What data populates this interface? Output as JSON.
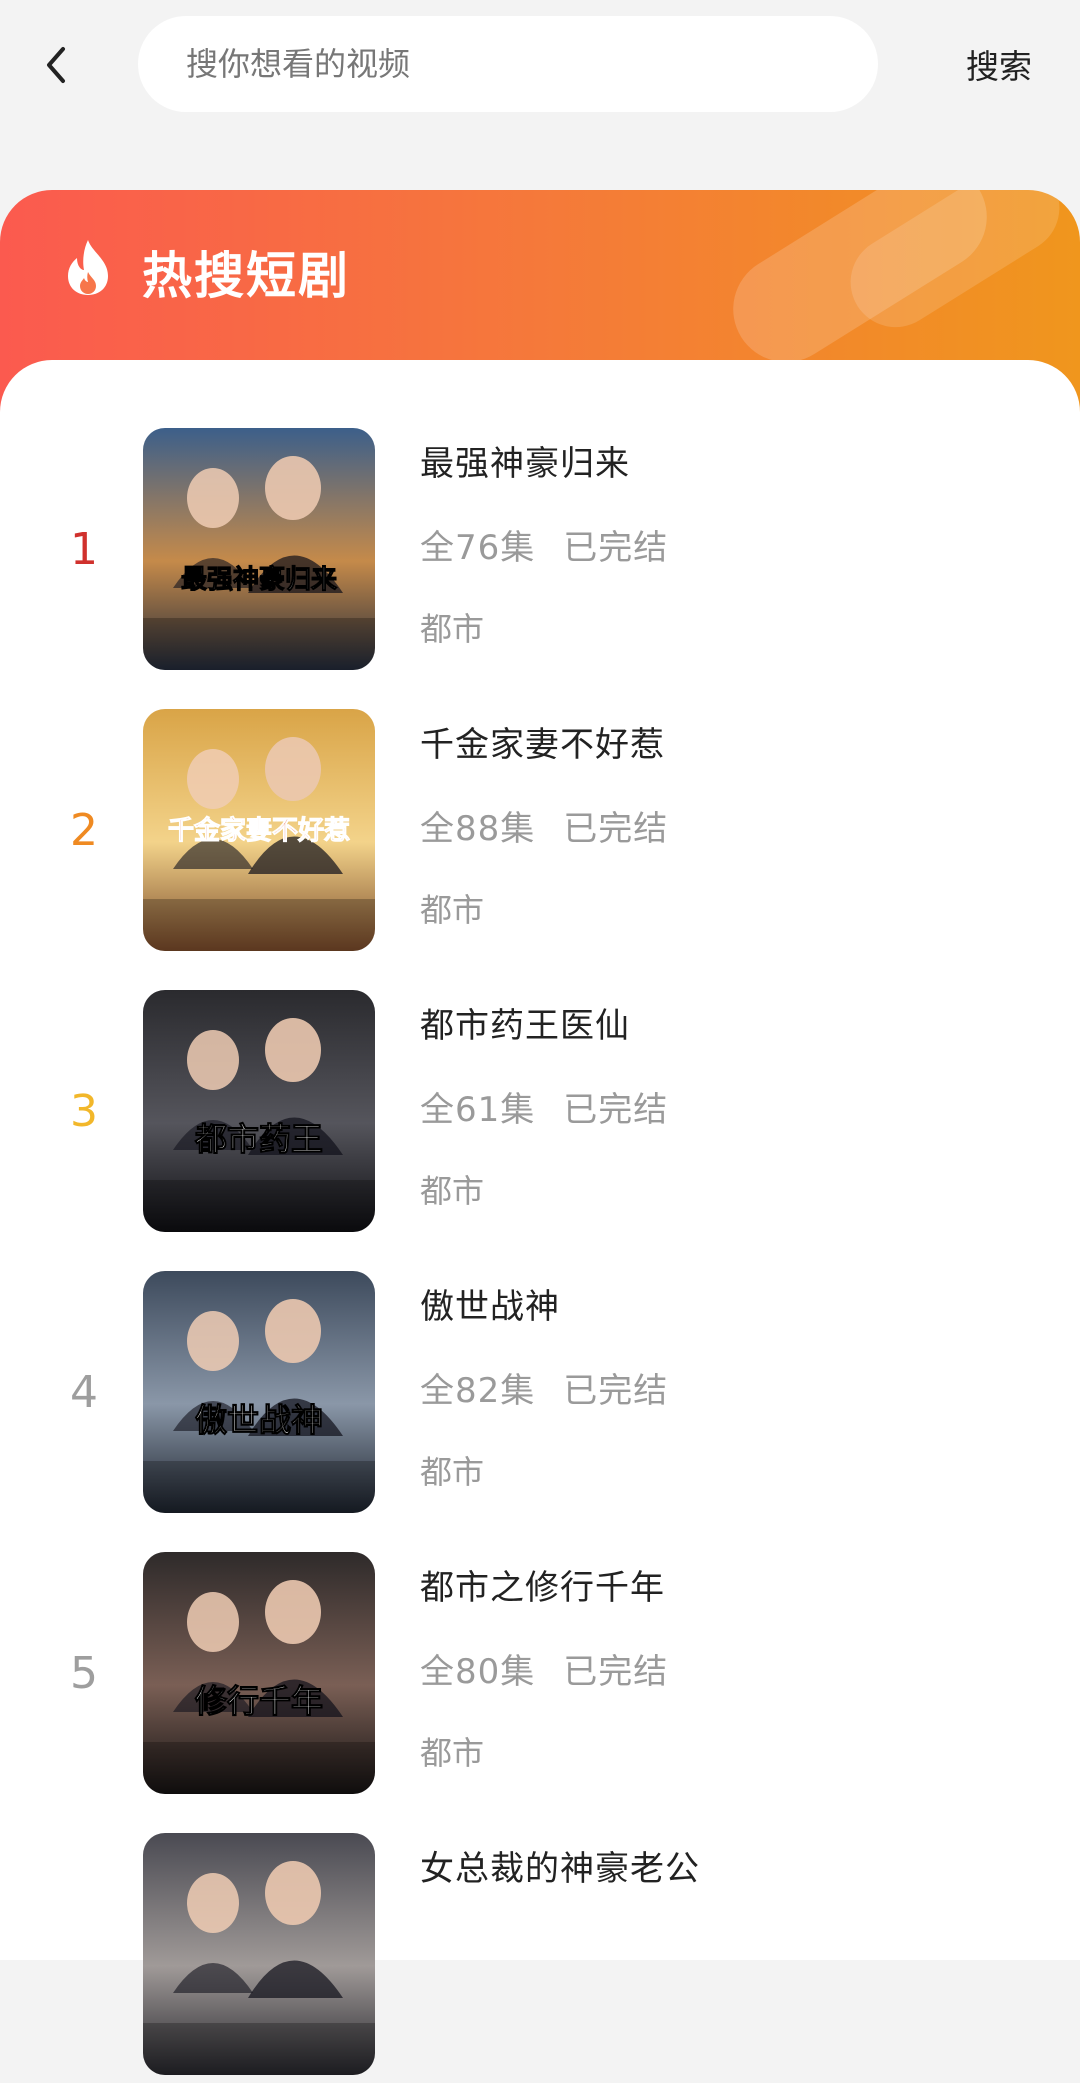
{
  "search": {
    "placeholder": "搜你想看的视频",
    "button_label": "搜索"
  },
  "section": {
    "title": "热搜短剧",
    "accent_gradient": [
      "#fb5a4f",
      "#f0961d"
    ]
  },
  "rank_colors": [
    "#d0312d",
    "#ef8a22",
    "#f2b72a",
    "#9e9e9e",
    "#9e9e9e",
    "#9e9e9e"
  ],
  "items": [
    {
      "rank": "1",
      "title": "最强神豪归来",
      "episodes": "全76集",
      "status": "已完结",
      "genre": "都市",
      "cover_text": "最强神豪归来"
    },
    {
      "rank": "2",
      "title": "千金家妻不好惹",
      "episodes": "全88集",
      "status": "已完结",
      "genre": "都市",
      "cover_text": "千金家妻不好惹"
    },
    {
      "rank": "3",
      "title": "都市药王医仙",
      "episodes": "全61集",
      "status": "已完结",
      "genre": "都市",
      "cover_text": "都市药王"
    },
    {
      "rank": "4",
      "title": "傲世战神",
      "episodes": "全82集",
      "status": "已完结",
      "genre": "都市",
      "cover_text": "傲世战神"
    },
    {
      "rank": "5",
      "title": "都市之修行千年",
      "episodes": "全80集",
      "status": "已完结",
      "genre": "都市",
      "cover_text": "修行千年"
    },
    {
      "rank": "",
      "title": "女总裁的神豪老公",
      "episodes": "",
      "status": "",
      "genre": "",
      "cover_text": ""
    }
  ]
}
